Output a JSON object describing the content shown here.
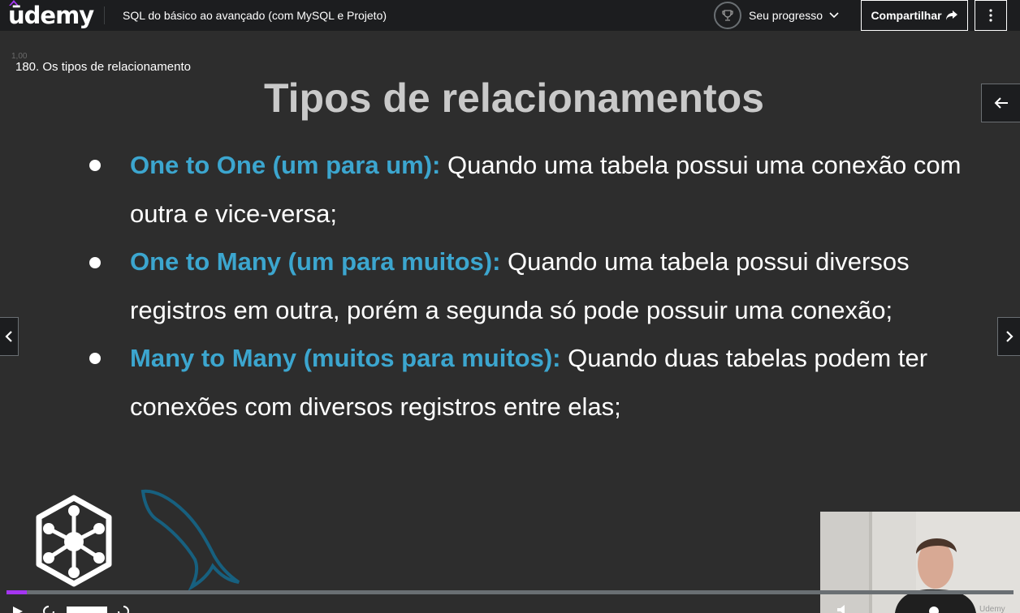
{
  "header": {
    "logo_text": "ūdemy",
    "course_title": "SQL do básico ao avançado (com MySQL e Projeto)",
    "progress_label": "Seu progresso",
    "share_label": "Compartilhar",
    "brand_color": "#a435f0"
  },
  "lecture": {
    "label": "180. Os tipos de relacionamento",
    "speed_ghost": "1,00"
  },
  "slide": {
    "title": "Tipos de relacionamentos",
    "items": [
      {
        "term": "One to One (um para um):",
        "line1": " Quando uma tabela possui uma conexão com",
        "line2": "outra e vice-versa;"
      },
      {
        "term": "One to Many (um para muitos):",
        "line1": " Quando uma tabela possui diversos",
        "line2": "registros em outra, porém a segunda só pode possuir uma conexão;"
      },
      {
        "term": "Many to Many (muitos para muitos):",
        "line1": " Quando duas tabelas podem ter",
        "line2": "conexões com diversos registros entre elas;"
      }
    ],
    "accent_color": "#3ca6cf"
  },
  "player": {
    "progress_fraction": 0.02,
    "webcam_watermark": "Udemy"
  },
  "icons": [
    "trophy-icon",
    "chevron-down-icon",
    "share-arrow-icon",
    "more-vertical-icon",
    "arrow-left-icon",
    "chevron-left-icon",
    "chevron-right-icon",
    "play-icon"
  ]
}
